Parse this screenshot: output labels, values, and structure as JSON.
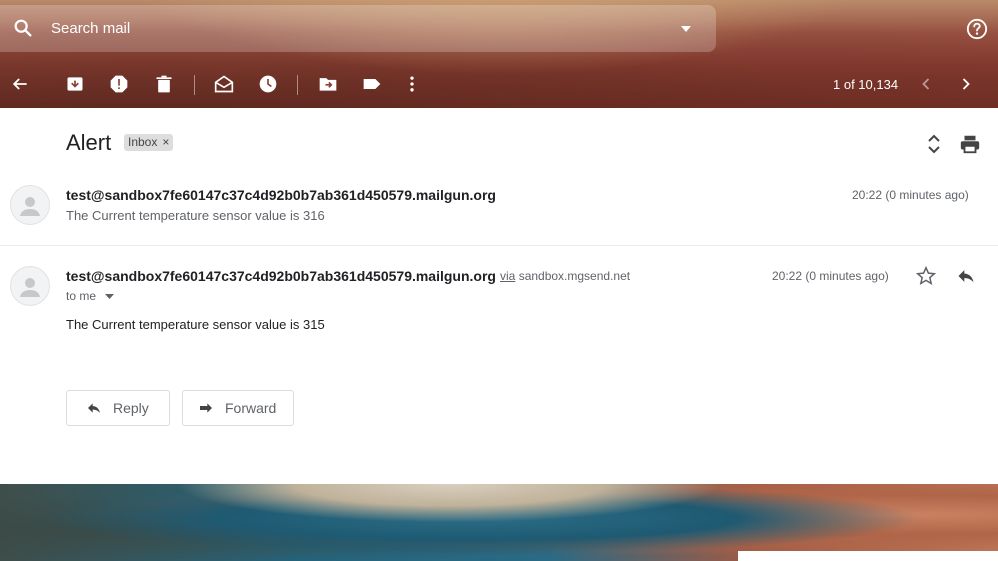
{
  "search": {
    "placeholder": "Search mail"
  },
  "pager": {
    "text": "1 of 10,134"
  },
  "toolbar_icons": [
    "back-arrow-icon",
    "archive-icon",
    "report-spam-icon",
    "delete-icon",
    "mark-unread-icon",
    "snooze-icon",
    "move-to-icon",
    "label-icon",
    "more-vert-icon"
  ],
  "thread": {
    "subject": "Alert",
    "label": "Inbox",
    "label_close": "×"
  },
  "messages": [
    {
      "sender": "test@sandbox7fe60147c37c4d92b0b7ab361d450579.mailgun.org",
      "time": "20:22 (0 minutes ago)",
      "snippet": "The Current temperature sensor value is 316"
    },
    {
      "sender": "test@sandbox7fe60147c37c4d92b0b7ab361d450579.mailgun.org",
      "via_word": "via",
      "via_domain": "sandbox.mgsend.net",
      "time": "20:22 (0 minutes ago)",
      "to": "to me",
      "body": "The Current temperature sensor value is 315"
    }
  ],
  "actions": {
    "reply": "Reply",
    "forward": "Forward"
  }
}
